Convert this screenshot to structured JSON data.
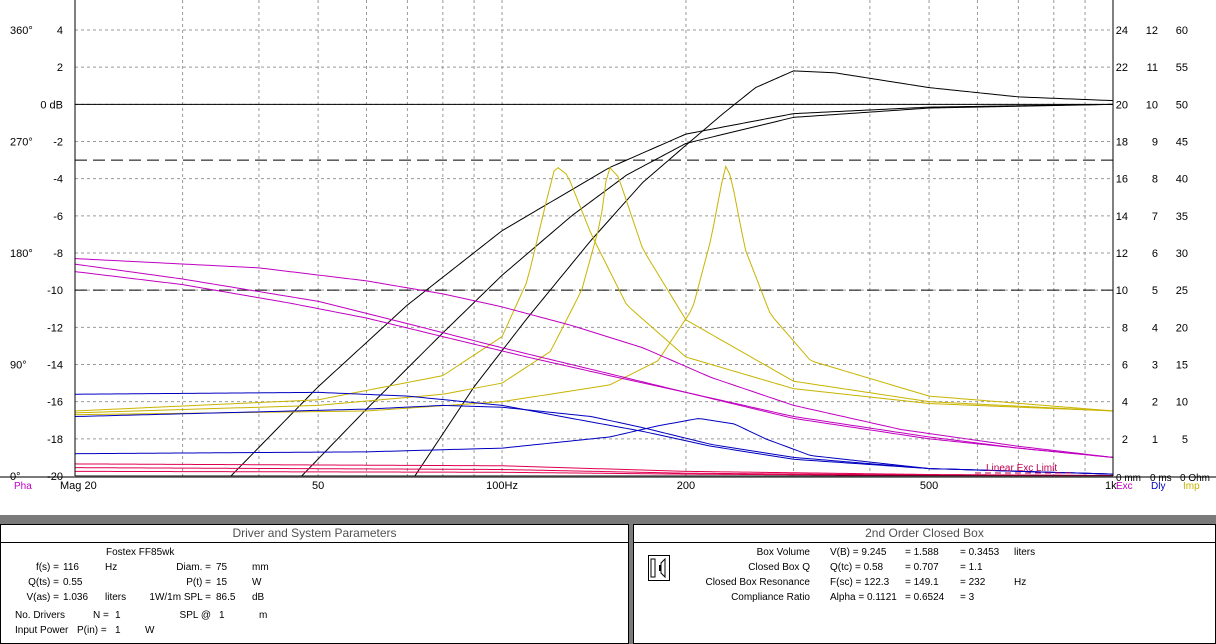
{
  "chart_data": {
    "type": "line",
    "x_axis": {
      "scale": "log",
      "range": [
        20,
        1000
      ],
      "tick_labels": [
        {
          "value": 20,
          "label": "Mag 20"
        },
        {
          "value": 50,
          "label": "50"
        },
        {
          "value": 100,
          "label": "100Hz"
        },
        {
          "value": 200,
          "label": "200"
        },
        {
          "value": 500,
          "label": "500"
        },
        {
          "value": 1000,
          "label": "1k"
        }
      ]
    },
    "y_axes": {
      "magnitude_db": {
        "range": [
          -20,
          4
        ],
        "ticks": [
          4,
          2,
          0,
          -2,
          -4,
          -6,
          -8,
          -10,
          -12,
          -14,
          -16,
          -18,
          -20
        ],
        "labels": [
          "4",
          "2",
          "0 dB",
          "-2",
          "-4",
          "-6",
          "-8",
          "-10",
          "-12",
          "-14",
          "-16",
          "-18",
          "-20"
        ]
      },
      "phase_deg": {
        "values": [
          0,
          90,
          180,
          270,
          360
        ],
        "labels": [
          "0°",
          "90°",
          "180°",
          "270°",
          "360°"
        ]
      },
      "excursion_mm": {
        "ticks": [
          24,
          22,
          20,
          18,
          16,
          14,
          12,
          10,
          8,
          6,
          4,
          2
        ],
        "zero_label": "0 mm"
      },
      "delay_ms": {
        "ticks": [
          12,
          11,
          10,
          9,
          8,
          7,
          6,
          5,
          4,
          3,
          2,
          1
        ],
        "zero_label": "0 ms"
      },
      "impedance_ohm": {
        "ticks": [
          60,
          55,
          50,
          45,
          40,
          35,
          30,
          25,
          20,
          15,
          10,
          5
        ],
        "zero_label": "0 Ohm"
      }
    },
    "axis_legend": [
      {
        "label": "Pha",
        "color": "#c000c0"
      },
      {
        "label": "Exc",
        "color": "#c000c0"
      },
      {
        "label": "Dly",
        "color": "#0000c0"
      },
      {
        "label": "Imp",
        "color": "#c8b400"
      }
    ],
    "annotation": {
      "text": "Linear Exc Limit",
      "color": "#c00050"
    },
    "reference_lines": [
      {
        "style": "solid",
        "y_db": 0
      },
      {
        "style": "dashed",
        "y_db": -3
      },
      {
        "style": "dashed",
        "y_db": -10
      }
    ],
    "series": [
      {
        "kind": "magnitude",
        "color": "#000000",
        "points": [
          [
            36,
            -20
          ],
          [
            50,
            -15.2
          ],
          [
            70,
            -10.8
          ],
          [
            100,
            -6.8
          ],
          [
            150,
            -3.4
          ],
          [
            200,
            -1.6
          ],
          [
            300,
            -0.5
          ],
          [
            500,
            -0.15
          ],
          [
            1000,
            0
          ]
        ]
      },
      {
        "kind": "magnitude",
        "color": "#000000",
        "points": [
          [
            47,
            -20
          ],
          [
            60,
            -16.4
          ],
          [
            80,
            -12.3
          ],
          [
            100,
            -9.2
          ],
          [
            130,
            -6.0
          ],
          [
            160,
            -3.8
          ],
          [
            200,
            -2.1
          ],
          [
            300,
            -0.7
          ],
          [
            500,
            -0.2
          ],
          [
            1000,
            0
          ]
        ]
      },
      {
        "kind": "magnitude",
        "color": "#000000",
        "points": [
          [
            72,
            -20
          ],
          [
            90,
            -15.2
          ],
          [
            110,
            -11.5
          ],
          [
            140,
            -7.3
          ],
          [
            170,
            -4.2
          ],
          [
            200,
            -2.2
          ],
          [
            230,
            -0.5
          ],
          [
            260,
            0.9
          ],
          [
            300,
            1.8
          ],
          [
            350,
            1.7
          ],
          [
            500,
            0.9
          ],
          [
            700,
            0.4
          ],
          [
            1000,
            0.2
          ]
        ]
      },
      {
        "kind": "impedance",
        "color": "#c8b400",
        "points": [
          [
            20,
            -16.5
          ],
          [
            50,
            -15.9
          ],
          [
            80,
            -14.6
          ],
          [
            100,
            -12.5
          ],
          [
            110,
            -9.5
          ],
          [
            118,
            -5.3
          ],
          [
            122.3,
            -3.3
          ],
          [
            128,
            -3.8
          ],
          [
            140,
            -7.0
          ],
          [
            160,
            -10.8
          ],
          [
            200,
            -13.6
          ],
          [
            300,
            -15.3
          ],
          [
            500,
            -16.1
          ],
          [
            1000,
            -16.5
          ]
        ]
      },
      {
        "kind": "impedance",
        "color": "#c8b400",
        "points": [
          [
            20,
            -16.6
          ],
          [
            50,
            -16.2
          ],
          [
            80,
            -15.6
          ],
          [
            100,
            -15.0
          ],
          [
            120,
            -13.3
          ],
          [
            135,
            -10.0
          ],
          [
            145,
            -6.3
          ],
          [
            149.1,
            -3.3
          ],
          [
            155,
            -3.9
          ],
          [
            170,
            -7.8
          ],
          [
            200,
            -11.6
          ],
          [
            300,
            -14.9
          ],
          [
            500,
            -16.0
          ],
          [
            1000,
            -16.5
          ]
        ]
      },
      {
        "kind": "impedance",
        "color": "#c8b400",
        "points": [
          [
            20,
            -16.7
          ],
          [
            60,
            -16.5
          ],
          [
            100,
            -16.0
          ],
          [
            150,
            -15.1
          ],
          [
            180,
            -13.8
          ],
          [
            205,
            -11.0
          ],
          [
            220,
            -7.2
          ],
          [
            228,
            -4.5
          ],
          [
            232,
            -3.3
          ],
          [
            237,
            -3.9
          ],
          [
            250,
            -7.8
          ],
          [
            275,
            -11.3
          ],
          [
            320,
            -13.8
          ],
          [
            500,
            -15.7
          ],
          [
            1000,
            -16.5
          ]
        ]
      },
      {
        "kind": "phase",
        "color": "#c000c0",
        "points": [
          [
            20,
            -8.3
          ],
          [
            40,
            -8.8
          ],
          [
            60,
            -9.5
          ],
          [
            80,
            -10.2
          ],
          [
            100,
            -10.9
          ],
          [
            130,
            -11.9
          ],
          [
            170,
            -13.1
          ],
          [
            220,
            -14.7
          ],
          [
            300,
            -16.2
          ],
          [
            450,
            -17.5
          ],
          [
            700,
            -18.4
          ],
          [
            1000,
            -19.0
          ]
        ]
      },
      {
        "kind": "phase",
        "color": "#c000c0",
        "points": [
          [
            20,
            -8.6
          ],
          [
            30,
            -9.4
          ],
          [
            50,
            -10.6
          ],
          [
            70,
            -11.8
          ],
          [
            100,
            -13.1
          ],
          [
            150,
            -14.5
          ],
          [
            200,
            -15.5
          ],
          [
            300,
            -16.8
          ],
          [
            500,
            -17.9
          ],
          [
            700,
            -18.5
          ],
          [
            1000,
            -19.0
          ]
        ]
      },
      {
        "kind": "phase",
        "color": "#c000c0",
        "points": [
          [
            20,
            -9.0
          ],
          [
            30,
            -9.7
          ],
          [
            45,
            -10.7
          ],
          [
            60,
            -11.5
          ],
          [
            80,
            -12.5
          ],
          [
            110,
            -13.6
          ],
          [
            150,
            -14.6
          ],
          [
            200,
            -15.5
          ],
          [
            300,
            -16.9
          ],
          [
            500,
            -18.0
          ],
          [
            700,
            -18.5
          ],
          [
            1000,
            -19.0
          ]
        ]
      },
      {
        "kind": "delay",
        "color": "#0000c0",
        "points": [
          [
            20,
            -15.6
          ],
          [
            50,
            -15.5
          ],
          [
            70,
            -15.7
          ],
          [
            100,
            -16.2
          ],
          [
            130,
            -16.9
          ],
          [
            170,
            -17.6
          ],
          [
            220,
            -18.4
          ],
          [
            300,
            -19.1
          ],
          [
            500,
            -19.6
          ],
          [
            1000,
            -19.9
          ]
        ]
      },
      {
        "kind": "delay",
        "color": "#0000c0",
        "points": [
          [
            20,
            -16.8
          ],
          [
            60,
            -16.4
          ],
          [
            80,
            -16.2
          ],
          [
            100,
            -16.3
          ],
          [
            140,
            -16.8
          ],
          [
            170,
            -17.4
          ],
          [
            220,
            -18.3
          ],
          [
            300,
            -19.0
          ],
          [
            500,
            -19.6
          ],
          [
            1000,
            -19.9
          ]
        ]
      },
      {
        "kind": "delay",
        "color": "#0000c0",
        "points": [
          [
            20,
            -18.8
          ],
          [
            60,
            -18.7
          ],
          [
            100,
            -18.5
          ],
          [
            150,
            -17.9
          ],
          [
            180,
            -17.3
          ],
          [
            210,
            -16.9
          ],
          [
            240,
            -17.2
          ],
          [
            270,
            -18.0
          ],
          [
            320,
            -18.9
          ],
          [
            500,
            -19.6
          ],
          [
            1000,
            -19.9
          ]
        ]
      },
      {
        "kind": "excursion",
        "color": "#e00050",
        "points": [
          [
            20,
            -19.35
          ],
          [
            100,
            -19.45
          ],
          [
            200,
            -19.75
          ],
          [
            500,
            -19.92
          ],
          [
            1000,
            -19.97
          ]
        ]
      },
      {
        "kind": "excursion",
        "color": "#e00050",
        "points": [
          [
            20,
            -19.55
          ],
          [
            100,
            -19.65
          ],
          [
            200,
            -19.85
          ],
          [
            500,
            -19.95
          ],
          [
            1000,
            -19.98
          ]
        ]
      },
      {
        "kind": "excursion",
        "color": "#e00050",
        "points": [
          [
            20,
            -19.75
          ],
          [
            100,
            -19.8
          ],
          [
            200,
            -19.9
          ],
          [
            500,
            -19.97
          ],
          [
            1000,
            -19.99
          ]
        ]
      }
    ]
  },
  "left_panel": {
    "title": "Driver and System Parameters",
    "driver_name": "Fostex  FF85wk",
    "fs": {
      "label": "f(s) =",
      "value": "116",
      "unit": "Hz"
    },
    "qts": {
      "label": "Q(ts) =",
      "value": "0.55"
    },
    "vas": {
      "label": "V(as) =",
      "value": "1.036",
      "unit": "liters"
    },
    "diam": {
      "label": "Diam. =",
      "value": "75",
      "unit": "mm"
    },
    "pt": {
      "label": "P(t) =",
      "value": "15",
      "unit": "W"
    },
    "spl": {
      "label": "1W/1m SPL =",
      "value": "86.5",
      "unit": "dB"
    },
    "nd": {
      "label": "No. Drivers",
      "eq": "N =",
      "value": "1"
    },
    "splat": {
      "label": "SPL @",
      "value": "1",
      "unit": "m"
    },
    "pin": {
      "label": "Input Power",
      "eq": "P(in) =",
      "value": "1",
      "unit": "W"
    }
  },
  "right_panel": {
    "title": "2nd Order Closed Box",
    "rows": [
      {
        "label": "Box Volume",
        "param": "V(B) = 9.245",
        "v2": "= 1.588",
        "v3": "= 0.3453",
        "unit": "liters"
      },
      {
        "label": "Closed Box Q",
        "param": "Q(tc) = 0.58",
        "v2": "= 0.707",
        "v3": "= 1.1",
        "unit": ""
      },
      {
        "label": "Closed Box Resonance",
        "param": "F(sc) = 122.3",
        "v2": "= 149.1",
        "v3": "= 232",
        "unit": "Hz"
      },
      {
        "label": "Compliance Ratio",
        "param": "Alpha = 0.1121",
        "v2": "= 0.6524",
        "v3": "= 3",
        "unit": ""
      }
    ]
  }
}
